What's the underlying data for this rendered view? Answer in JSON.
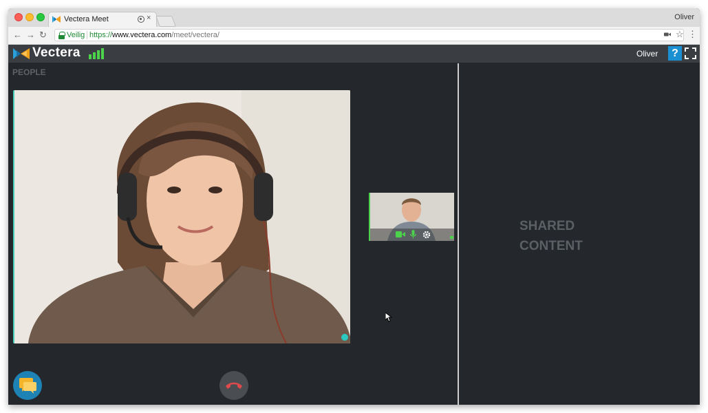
{
  "browser": {
    "tab_title": "Vectera Meet",
    "tab_close": "×",
    "profile_name": "Oliver",
    "security_label": "Veilig",
    "url_scheme": "https://",
    "url_host": "www.vectera.com",
    "url_path": "/meet/vectera/"
  },
  "app": {
    "brand_name": "Vectera",
    "user_name": "Oliver",
    "help_label": "?",
    "people_label": "PEOPLE",
    "shared_content_line1": "SHARED",
    "shared_content_line2": "CONTENT"
  },
  "icons": {
    "back": "back-arrow-icon",
    "forward": "forward-arrow-icon",
    "reload": "reload-icon",
    "camera": "camera-icon",
    "star": "bookmark-star-icon",
    "menu": "kebab-menu-icon",
    "signal": "connection-signal-icon",
    "fullscreen": "fullscreen-icon",
    "chat": "chat-icon",
    "hangup": "hang-up-phone-icon",
    "mic": "microphone-icon",
    "settings": "gear-icon"
  },
  "colors": {
    "accent_blue": "#1a8fd1",
    "signal_green": "#4cd24b",
    "hangup_red": "#e04a4a",
    "app_background": "#24272b",
    "header_background": "#3a3e43"
  }
}
